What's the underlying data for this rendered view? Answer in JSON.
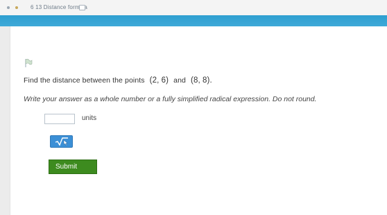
{
  "breadcrumb": {
    "text": "6 13 Distance formula"
  },
  "question": {
    "prefix": "Find the distance between the points",
    "point1": "(2, 6)",
    "connector": "and",
    "point2": "(8, 8).",
    "instructions": "Write your answer as a whole number or a fully simplified radical expression. Do not round."
  },
  "answer": {
    "value": "",
    "units_label": "units"
  },
  "submit": {
    "label": "Submit"
  },
  "colors": {
    "accent_band": "#2f9fd0",
    "submit_green": "#3d8b1f",
    "keypad_blue": "#3b8fd6"
  },
  "icons": {
    "flag": "flag-icon",
    "sqrt": "square-root-icon",
    "crumb": "external-icon"
  }
}
